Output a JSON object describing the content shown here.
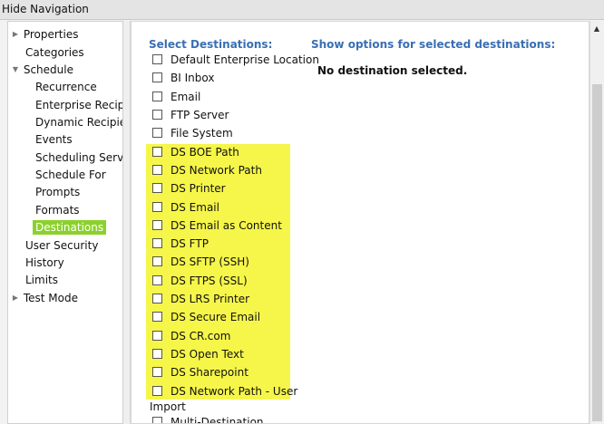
{
  "topbar": {
    "title": "Hide Navigation"
  },
  "sidebar": {
    "items": [
      {
        "label": "Properties",
        "expander": "▶",
        "indent": 0
      },
      {
        "label": "Categories",
        "expander": "",
        "indent": 0
      },
      {
        "label": "Schedule",
        "expander": "▼",
        "indent": 0
      },
      {
        "label": "Recurrence",
        "expander": "",
        "indent": 1
      },
      {
        "label": "Enterprise Recipien",
        "expander": "",
        "indent": 1
      },
      {
        "label": "Dynamic Recipients",
        "expander": "",
        "indent": 1
      },
      {
        "label": "Events",
        "expander": "",
        "indent": 1
      },
      {
        "label": "Scheduling Server (",
        "expander": "",
        "indent": 1
      },
      {
        "label": "Schedule For",
        "expander": "",
        "indent": 1
      },
      {
        "label": "Prompts",
        "expander": "",
        "indent": 1
      },
      {
        "label": "Formats",
        "expander": "",
        "indent": 1
      },
      {
        "label": "Destinations",
        "expander": "",
        "indent": 1,
        "active": true
      },
      {
        "label": "User Security",
        "expander": "",
        "indent": 0
      },
      {
        "label": "History",
        "expander": "",
        "indent": 0
      },
      {
        "label": "Limits",
        "expander": "",
        "indent": 0
      },
      {
        "label": "Test Mode",
        "expander": "▶",
        "indent": 0
      }
    ]
  },
  "main": {
    "select_heading": "Select Destinations:",
    "options_heading": "Show options for selected destinations:",
    "no_selection": "No destination selected.",
    "destinations": [
      {
        "label": "Default Enterprise Location",
        "checked": false,
        "highlighted": false
      },
      {
        "label": "BI Inbox",
        "checked": false,
        "highlighted": false
      },
      {
        "label": "Email",
        "checked": false,
        "highlighted": false
      },
      {
        "label": "FTP Server",
        "checked": false,
        "highlighted": false
      },
      {
        "label": "File System",
        "checked": false,
        "highlighted": false
      },
      {
        "label": "DS BOE Path",
        "checked": false,
        "highlighted": true
      },
      {
        "label": "DS Network Path",
        "checked": false,
        "highlighted": true
      },
      {
        "label": "DS Printer",
        "checked": false,
        "highlighted": true
      },
      {
        "label": "DS Email",
        "checked": false,
        "highlighted": true
      },
      {
        "label": "DS Email as Content",
        "checked": false,
        "highlighted": true
      },
      {
        "label": "DS FTP",
        "checked": false,
        "highlighted": true
      },
      {
        "label": "DS SFTP (SSH)",
        "checked": false,
        "highlighted": true
      },
      {
        "label": "DS FTPS (SSL)",
        "checked": false,
        "highlighted": true
      },
      {
        "label": "DS LRS Printer",
        "checked": false,
        "highlighted": true
      },
      {
        "label": "DS Secure Email",
        "checked": false,
        "highlighted": true
      },
      {
        "label": "DS CR.com",
        "checked": false,
        "highlighted": true
      },
      {
        "label": "DS Open Text",
        "checked": false,
        "highlighted": true
      },
      {
        "label": "DS Sharepoint",
        "checked": false,
        "highlighted": true
      },
      {
        "label": "DS Network Path - User",
        "checked": false,
        "highlighted": true
      }
    ],
    "import_label": "Import",
    "import_options": [
      {
        "label": "Multi-Destination",
        "checked": false
      }
    ],
    "highlight_color": "#f6f64a"
  },
  "colors": {
    "heading": "#3a6fb3",
    "active_nav": "#8bd12d"
  }
}
